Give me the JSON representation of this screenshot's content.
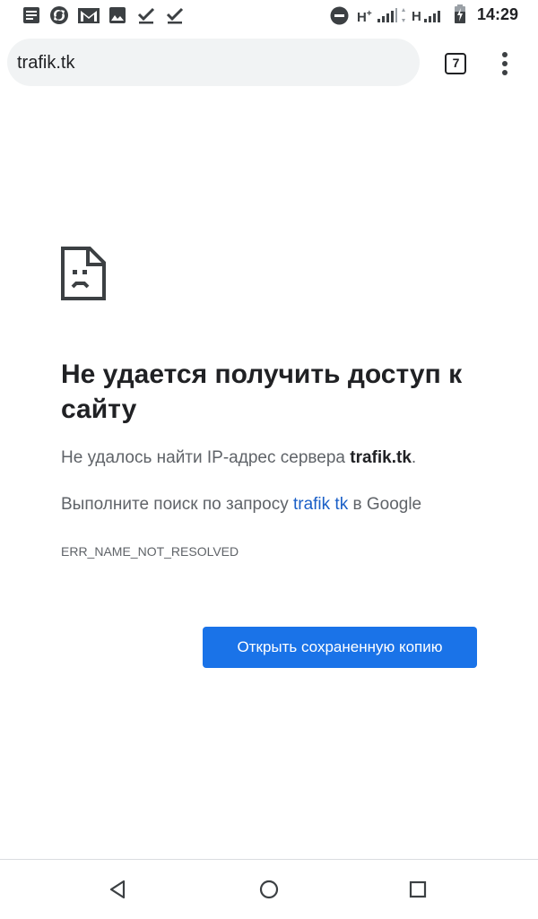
{
  "status_bar": {
    "time": "14:29",
    "net1": "H",
    "net1_sup": "+",
    "net2": "H",
    "icons": [
      "notes-icon",
      "sync-icon",
      "gmail-icon",
      "image-icon",
      "check-icon",
      "check-icon",
      "do-not-disturb-icon",
      "signal-icon",
      "signal-icon",
      "battery-icon"
    ]
  },
  "toolbar": {
    "url": "trafik.tk",
    "tab_count": "7"
  },
  "page": {
    "heading": "Не удается получить доступ к сайту",
    "msg1_before": "Не удалось найти IP-адрес сервера ",
    "msg1_bold": "trafik.tk",
    "msg1_after": ".",
    "msg2_before": "Выполните поиск по запросу ",
    "msg2_link": "trafik tk",
    "msg2_after": " в Google",
    "error_code": "ERR_NAME_NOT_RESOLVED",
    "button_label": "Открыть сохраненную копию"
  },
  "colors": {
    "accent": "#1a73e8",
    "link": "#1a5fc7",
    "omnibox_bg": "#f1f3f4"
  }
}
